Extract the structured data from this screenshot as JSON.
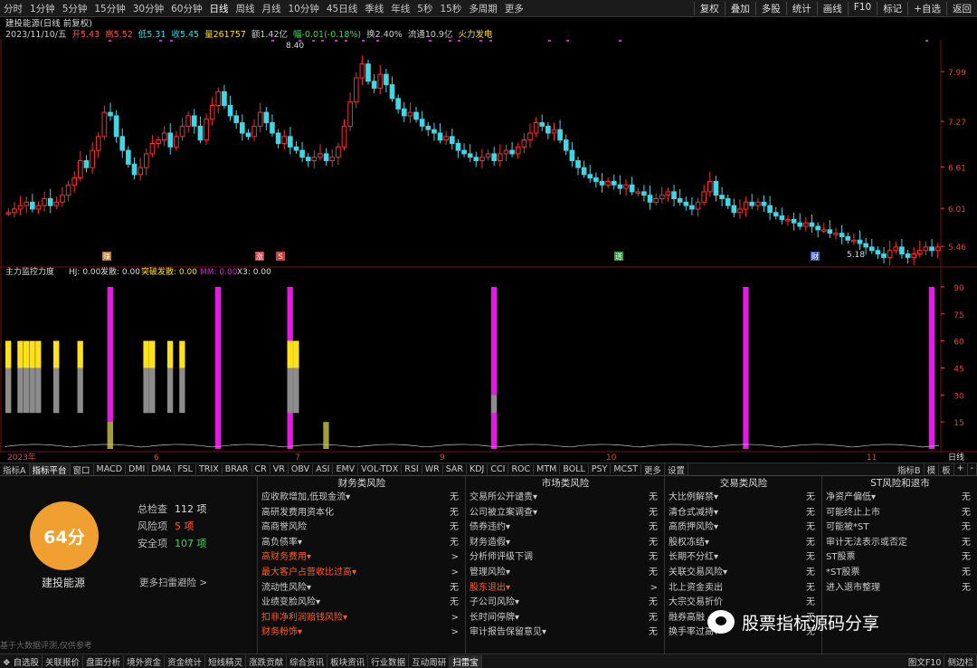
{
  "topbar": {
    "timeframes": [
      "分时",
      "1分钟",
      "5分钟",
      "15分钟",
      "30分钟",
      "60分钟",
      "日线",
      "周线",
      "月线",
      "10分钟",
      "45日线",
      "季线",
      "年线",
      "5秒",
      "15秒",
      "多周期",
      "更多"
    ],
    "active": "日线",
    "tools": [
      "复权",
      "叠加",
      "多股",
      "统计",
      "画线",
      "F10",
      "标记",
      "+自选",
      "返回"
    ]
  },
  "info": {
    "title": "建投能源(日线 前复权)",
    "date": "2023/11/10/五",
    "open": "开5.43",
    "high": "高5.52",
    "low": "低5.31",
    "close": "收5.45",
    "volume": "量261757",
    "amount": "额1.42亿",
    "change": "幅-0.01(-0.18%)",
    "turnover": "换2.40%",
    "float": "流通10.9亿",
    "sector": "火力发电"
  },
  "chart_data": [
    {
      "type": "candlestick",
      "title": "建投能源(日线 前复权)",
      "y_ticks": [
        7.99,
        7.27,
        6.61,
        6.01,
        5.46
      ],
      "ylim": [
        5.2,
        8.45
      ],
      "x_tick_labels": [
        "2023年",
        "6",
        "7",
        "9",
        "10",
        "11"
      ],
      "annotations": [
        "8.40",
        "5.18"
      ],
      "markers": [
        "赚",
        "涨",
        "S",
        "送",
        "财"
      ],
      "closes": [
        5.95,
        6.0,
        6.05,
        6.1,
        6.0,
        6.05,
        6.15,
        6.05,
        6.1,
        6.2,
        6.35,
        6.45,
        6.7,
        6.6,
        6.85,
        7.05,
        7.4,
        7.35,
        7.05,
        6.85,
        6.65,
        6.5,
        6.6,
        6.8,
        6.95,
        7.0,
        7.1,
        6.9,
        7.05,
        7.2,
        7.35,
        7.2,
        7.0,
        7.3,
        7.5,
        7.7,
        7.5,
        7.35,
        7.25,
        7.1,
        7.05,
        7.2,
        7.4,
        7.25,
        7.1,
        6.95,
        7.05,
        6.9,
        6.85,
        6.75,
        6.7,
        6.75,
        6.8,
        6.7,
        6.75,
        6.9,
        7.2,
        7.55,
        7.9,
        8.1,
        7.85,
        7.75,
        7.95,
        7.8,
        7.6,
        7.45,
        7.35,
        7.4,
        7.3,
        7.2,
        7.15,
        7.1,
        7.0,
        7.05,
        6.95,
        6.85,
        6.8,
        6.75,
        6.7,
        6.75,
        6.8,
        6.7,
        6.8,
        6.85,
        6.8,
        6.9,
        7.0,
        7.1,
        7.25,
        7.2,
        7.1,
        7.15,
        7.0,
        6.85,
        6.7,
        6.6,
        6.5,
        6.45,
        6.4,
        6.35,
        6.4,
        6.35,
        6.3,
        6.35,
        6.25,
        6.25,
        6.2,
        6.1,
        6.15,
        6.2,
        6.25,
        6.15,
        6.1,
        6.05,
        6.0,
        6.1,
        6.25,
        6.4,
        6.2,
        6.15,
        6.05,
        5.95,
        6.0,
        6.1,
        6.05,
        6.1,
        6.05,
        5.95,
        5.9,
        5.85,
        5.85,
        5.8,
        5.75,
        5.8,
        5.75,
        5.7,
        5.7,
        5.65,
        5.65,
        5.6,
        5.55,
        5.55,
        5.5,
        5.45,
        5.4,
        5.35,
        5.3,
        5.4,
        5.45,
        5.35,
        5.3,
        5.35,
        5.4,
        5.45,
        5.4,
        5.45
      ]
    },
    {
      "type": "bar",
      "title": "主力监控力度",
      "legend": [
        "HJ: 0.00",
        "发散: 0.00",
        "突破发散: 0.00",
        "MM: 0.00",
        "X3: 0.00"
      ],
      "y_ticks": [
        90.0,
        75.0,
        60.0,
        45.0,
        30.0,
        15.0
      ],
      "ylim": [
        0,
        96
      ],
      "bars": [
        {
          "i": 0,
          "red": 90,
          "yellow": 60,
          "gray": 45
        },
        {
          "i": 2,
          "yellow": 60,
          "gray": 45
        },
        {
          "i": 3,
          "yellow": 60,
          "gray": 45
        },
        {
          "i": 4,
          "yellow": 60,
          "gray": 45
        },
        {
          "i": 5,
          "yellow": 60,
          "gray": 45
        },
        {
          "i": 8,
          "red": 90,
          "yellow": 60,
          "gray": 45
        },
        {
          "i": 9,
          "red": 90
        },
        {
          "i": 10,
          "red": 90
        },
        {
          "i": 11,
          "red": 90
        },
        {
          "i": 12,
          "yellow": 60,
          "gray": 45
        },
        {
          "i": 17,
          "magenta": 90,
          "olive": 15
        },
        {
          "i": 23,
          "red": 90,
          "yellow": 60,
          "gray": 45
        },
        {
          "i": 24,
          "red": 90,
          "yellow": 60,
          "gray": 45
        },
        {
          "i": 25,
          "red": 90
        },
        {
          "i": 27,
          "yellow": 60,
          "gray": 45
        },
        {
          "i": 29,
          "yellow": 60,
          "gray": 45
        },
        {
          "i": 35,
          "magenta": 90
        },
        {
          "i": 47,
          "red": 90,
          "magenta": 90,
          "yellow": 60,
          "gray": 45
        },
        {
          "i": 48,
          "red": 90,
          "yellow": 60,
          "gray": 45
        },
        {
          "i": 49,
          "red": 90
        },
        {
          "i": 50,
          "red": 90
        },
        {
          "i": 51,
          "red": 90
        },
        {
          "i": 53,
          "olive": 15
        },
        {
          "i": 81,
          "magenta": 90,
          "gray": 30
        },
        {
          "i": 123,
          "magenta": 90
        },
        {
          "i": 154,
          "magenta": 90
        },
        {
          "i": 165,
          "magenta": 90
        },
        {
          "i": 166,
          "magenta": 90
        },
        {
          "i": 167,
          "magenta": 90
        }
      ]
    }
  ],
  "tabs": {
    "items": [
      "指标A",
      "指标平台",
      "窗口",
      "MACD",
      "DMI",
      "DMA",
      "FSL",
      "TRIX",
      "BRAR",
      "CR",
      "VR",
      "OBV",
      "ASI",
      "EMV",
      "VOL-TDX",
      "RSI",
      "WR",
      "SAR",
      "KDJ",
      "CCI",
      "ROC",
      "MTM",
      "BOLL",
      "PSY",
      "MCST",
      "更多",
      "设置"
    ],
    "active": "指标平台",
    "right": [
      "指标B",
      "模",
      "板",
      "+",
      "-"
    ]
  },
  "panel": {
    "score": "64分",
    "company": "建投能源",
    "total_label": "总检查",
    "total_value": "112 项",
    "risk_label": "风险项",
    "risk_value": "5 项",
    "safe_label": "安全项",
    "safe_value": "107 项",
    "more": "更多扫雷避险 >",
    "disclaimer": "基于大数据评测,仅供参考",
    "columns": [
      {
        "title": "财务类风险",
        "rows": [
          {
            "label": "应收款增加,低现金流▾",
            "value": "无"
          },
          {
            "label": "高研发费用资本化",
            "value": "无"
          },
          {
            "label": "高商誉风险",
            "value": "无"
          },
          {
            "label": "高负债率▾",
            "value": "无"
          },
          {
            "label": "高财务费用▾",
            "value": ">",
            "hl": true
          },
          {
            "label": "最大客户占营收比过高▾",
            "value": ">",
            "hl": true
          },
          {
            "label": "流动性风险▾",
            "value": "无"
          },
          {
            "label": "业绩变脸风险▾",
            "value": "无"
          },
          {
            "label": "扣非净利润赔钱风险▾",
            "value": ">",
            "hl": true
          },
          {
            "label": "财务粉饰▾",
            "value": ">",
            "hl": true
          }
        ]
      },
      {
        "title": "市场类风险",
        "rows": [
          {
            "label": "交易所公开谴责▾",
            "value": "无"
          },
          {
            "label": "公司被立案调查▾",
            "value": "无"
          },
          {
            "label": "债券违约▾",
            "value": "无"
          },
          {
            "label": "财务造假▾",
            "value": "无"
          },
          {
            "label": "分析师评级下调",
            "value": "无"
          },
          {
            "label": "管理风险▾",
            "value": "无"
          },
          {
            "label": "股东退出▾",
            "value": ">",
            "hl": true
          },
          {
            "label": "子公司风险▾",
            "value": "无"
          },
          {
            "label": "长时间停牌▾",
            "value": "无"
          },
          {
            "label": "审计报告保留意见▾",
            "value": "无"
          }
        ]
      },
      {
        "title": "交易类风险",
        "rows": [
          {
            "label": "大比例解禁▾",
            "value": "无"
          },
          {
            "label": "清仓式减持▾",
            "value": "无"
          },
          {
            "label": "高质押风险▾",
            "value": "无"
          },
          {
            "label": "股权冻结▾",
            "value": "无"
          },
          {
            "label": "长期不分红▾",
            "value": "无"
          },
          {
            "label": "关联交易风险▾",
            "value": "无"
          },
          {
            "label": "北上资金卖出",
            "value": "无"
          },
          {
            "label": "大宗交易折价",
            "value": "无"
          },
          {
            "label": "融券高融",
            "value": "无"
          },
          {
            "label": "换手率过高▾",
            "value": "无"
          }
        ]
      },
      {
        "title": "ST风险和退市",
        "rows": [
          {
            "label": "净资产偏低▾",
            "value": "无"
          },
          {
            "label": "可能终止上市",
            "value": "无"
          },
          {
            "label": "可能被*ST",
            "value": "无"
          },
          {
            "label": "审计无法表示或否定",
            "value": "无"
          },
          {
            "label": "ST股票",
            "value": "无"
          },
          {
            "label": "*ST股票",
            "value": "无"
          },
          {
            "label": "进入退市整理",
            "value": "无"
          }
        ]
      }
    ]
  },
  "bottombar": {
    "items": [
      "❖ 自选股",
      "关联报价",
      "盘面分析",
      "境外资金",
      "资金统计",
      "短线精灵",
      "涨跌贡献",
      "综合资讯",
      "板块资讯",
      "行业数据",
      "互动周研",
      "扫雷宝"
    ],
    "active": "扫雷宝",
    "right": [
      "图文F10",
      "侧边栏"
    ]
  },
  "watermark": "股票指标源码分享",
  "colors": {
    "up": "#ff2d2d",
    "down": "#3fd7e6",
    "magenta": "#e619e6",
    "yellow": "#ffe11a",
    "gray": "#8c8c8c",
    "olive": "#a0a033",
    "orange": "#f0a030"
  }
}
